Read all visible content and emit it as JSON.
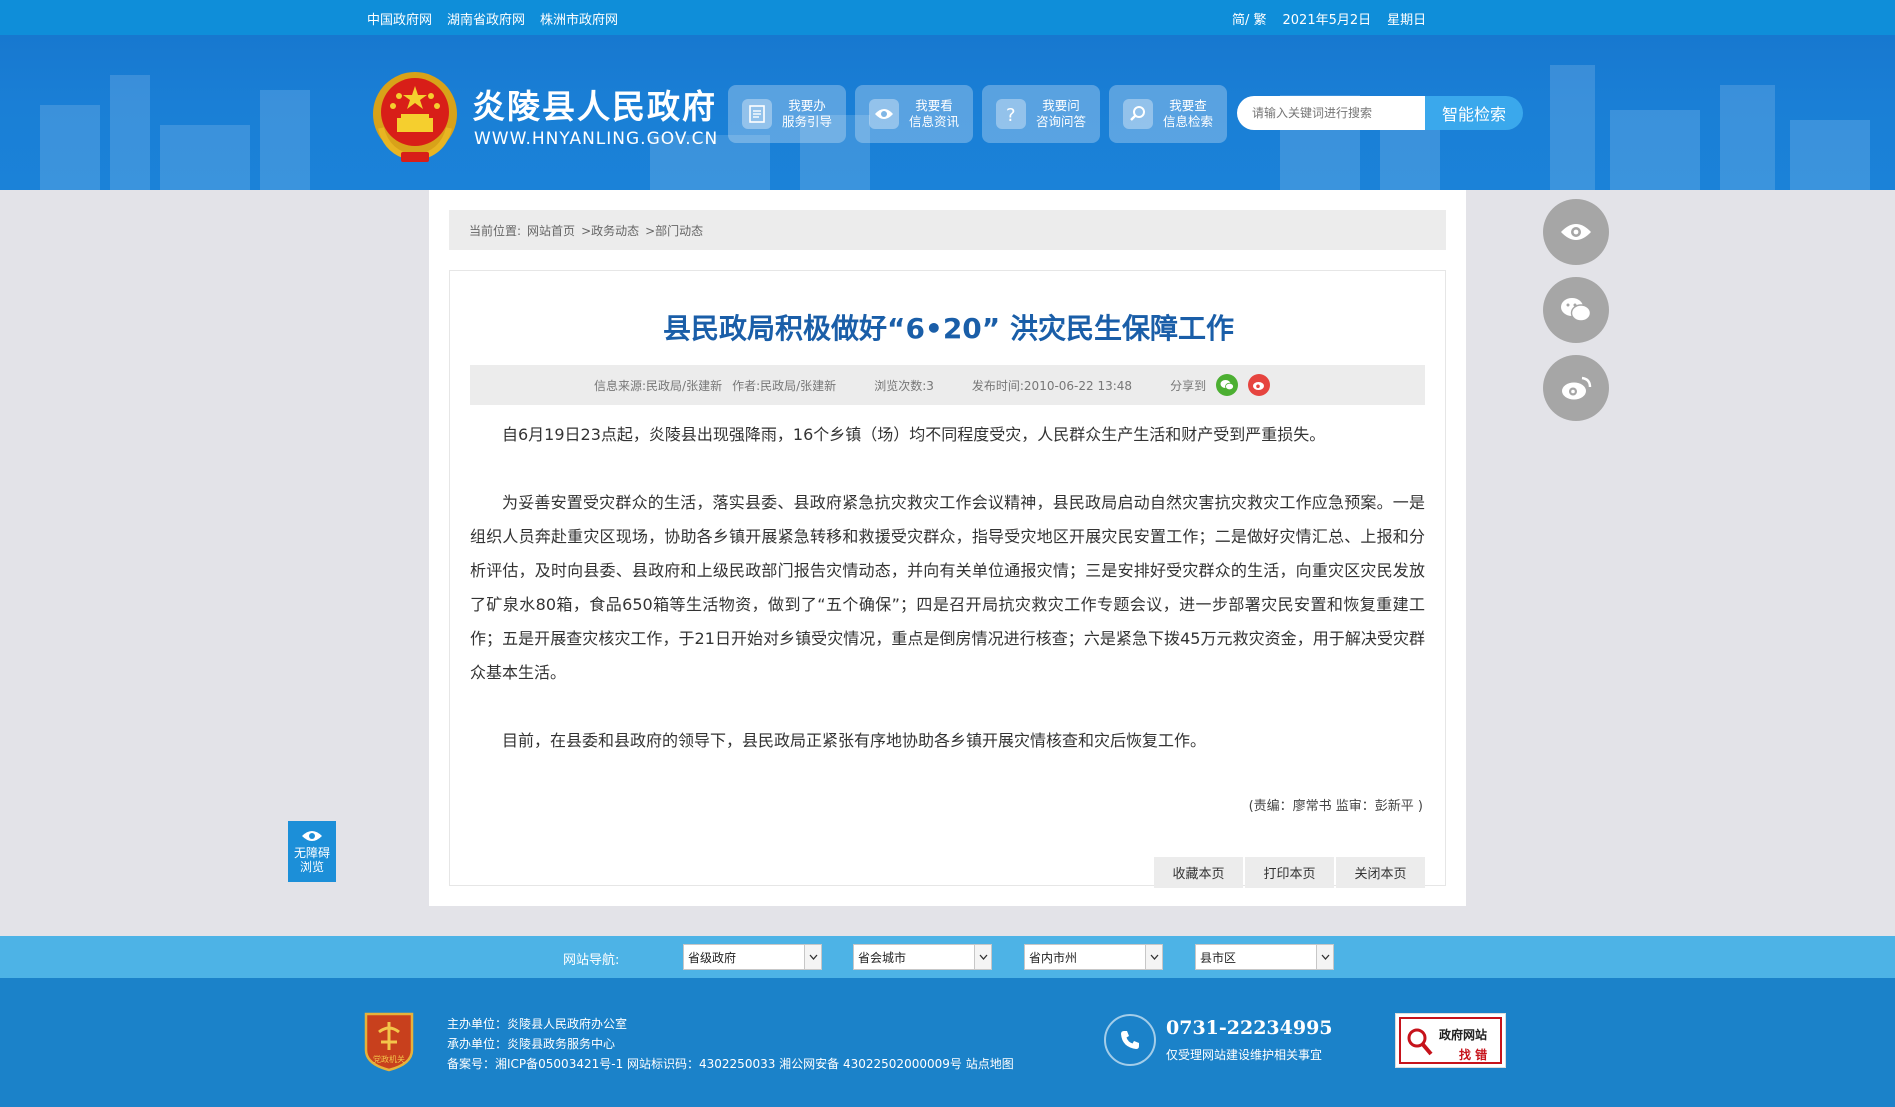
{
  "topbar": {
    "links": [
      "中国政府网",
      "湖南省政府网",
      "株洲市政府网"
    ],
    "lang": "简/ 繁",
    "date": "2021年5月2日",
    "weekday": "星期日"
  },
  "header": {
    "site_name": "炎陵县人民政府",
    "domain": "WWW.HNYANLING.GOV.CN",
    "quick_links": [
      {
        "line1": "我要办",
        "line2": "服务引导",
        "icon": "document-icon"
      },
      {
        "line1": "我要看",
        "line2": "信息资讯",
        "icon": "eye-icon"
      },
      {
        "line1": "我要问",
        "line2": "咨询问答",
        "icon": "question-icon"
      },
      {
        "line1": "我要查",
        "line2": "信息检索",
        "icon": "search-icon"
      }
    ],
    "search_placeholder": "请输入关键词进行搜索",
    "search_button": "智能检索"
  },
  "breadcrumb": {
    "prefix": "当前位置:",
    "items": [
      "网站首页",
      ">政务动态",
      ">部门动态"
    ]
  },
  "article": {
    "title": "县民政局积极做好“6•20” 洪灾民生保障工作",
    "meta": {
      "source": "信息来源:民政局/张建新",
      "author": "作者:民政局/张建新",
      "views": "浏览次数:3",
      "published": "发布时间:2010-06-22 13:48",
      "share": "分享到"
    },
    "paragraphs": [
      "自6月19日23点起，炎陵县出现强降雨，16个乡镇（场）均不同程度受灾，人民群众生产生活和财产受到严重损失。",
      "为妥善安置受灾群众的生活，落实县委、县政府紧急抗灾救灾工作会议精神，县民政局启动自然灾害抗灾救灾工作应急预案。一是组织人员奔赴重灾区现场，协助各乡镇开展紧急转移和救援受灾群众，指导受灾地区开展灾民安置工作；二是做好灾情汇总、上报和分析评估，及时向县委、县政府和上级民政部门报告灾情动态，并向有关单位通报灾情；三是安排好受灾群众的生活，向重灾区灾民发放了矿泉水80箱，食品650箱等生活物资，做到了“五个确保”；四是召开局抗灾救灾工作专题会议，进一步部署灾民安置和恢复重建工作；五是开展查灾核灾工作，于21日开始对乡镇受灾情况，重点是倒房情况进行核查；六是紧急下拨45万元救灾资金，用于解决受灾群众基本生活。",
      "目前，在县委和县政府的领导下，县民政局正紧张有序地协助各乡镇开展灾情核查和灾后恢复工作。"
    ],
    "editor": "(责编：廖常书   监审：彭新平 )",
    "actions": [
      "收藏本页",
      "打印本页",
      "关闭本页"
    ]
  },
  "accessibility": {
    "line1": "无障碍",
    "line2": "浏览"
  },
  "sitenav": {
    "label": "网站导航:",
    "selects": [
      "省级政府",
      "省会城市",
      "省内市州",
      "县市区"
    ]
  },
  "footer": {
    "badge_text": "党政机关",
    "host": "主办单位：炎陵县人民政府办公室",
    "organizer": "承办单位：炎陵县政务服务中心",
    "record": "备案号：湘ICP备05003421号-1  网站标识码：4302250033  湘公网安备 43022502000009号  站点地图",
    "phone": "0731-22234995",
    "phone_note": "仅受理网站建设维护相关事宜",
    "fix_line1": "政府网站",
    "fix_line2": "找 错"
  },
  "colors": {
    "topbar": "#0f8ed9",
    "header": "#1a7fd6",
    "title": "#1a5ea8",
    "navbar": "#4db3e6",
    "footer": "#1b82c9"
  }
}
